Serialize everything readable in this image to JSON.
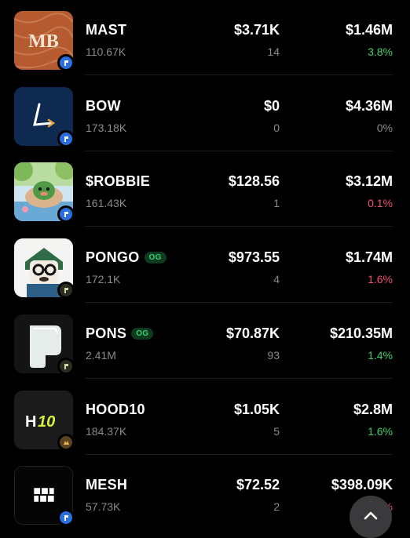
{
  "tokens": [
    {
      "name": "MAST",
      "holders": "110.67K",
      "price": "$3.71K",
      "count": "14",
      "mcap": "$1.46M",
      "change": "3.8%",
      "trend": "up",
      "og": false,
      "logo_text": "MB"
    },
    {
      "name": "BOW",
      "holders": "173.18K",
      "price": "$0",
      "count": "0",
      "mcap": "$4.36M",
      "change": "0%",
      "trend": "flat",
      "og": false
    },
    {
      "name": "$ROBBIE",
      "holders": "161.43K",
      "price": "$128.56",
      "count": "1",
      "mcap": "$3.12M",
      "change": "0.1%",
      "trend": "down",
      "og": false
    },
    {
      "name": "PONGO",
      "holders": "172.1K",
      "price": "$973.55",
      "count": "4",
      "mcap": "$1.74M",
      "change": "1.6%",
      "trend": "down",
      "og": true
    },
    {
      "name": "PONS",
      "holders": "2.41M",
      "price": "$70.87K",
      "count": "93",
      "mcap": "$210.35M",
      "change": "1.4%",
      "trend": "up",
      "og": true
    },
    {
      "name": "HOOD10",
      "holders": "184.37K",
      "price": "$1.05K",
      "count": "5",
      "mcap": "$2.8M",
      "change": "1.6%",
      "trend": "up",
      "og": false,
      "logo_text": "H",
      "logo_accent": "10"
    },
    {
      "name": "MESH",
      "holders": "57.73K",
      "price": "$72.52",
      "count": "2",
      "mcap": "$398.09K",
      "change": "%",
      "trend": "down",
      "og": false
    }
  ],
  "og_label": "OG",
  "colors": {
    "up": "#3fcf6a",
    "down": "#f0506e",
    "flat": "#8a8a8a",
    "background": "#000000"
  },
  "icons": {
    "scroll_top": "chevron-up-icon",
    "chain_badge": "chain-badge-icon"
  }
}
